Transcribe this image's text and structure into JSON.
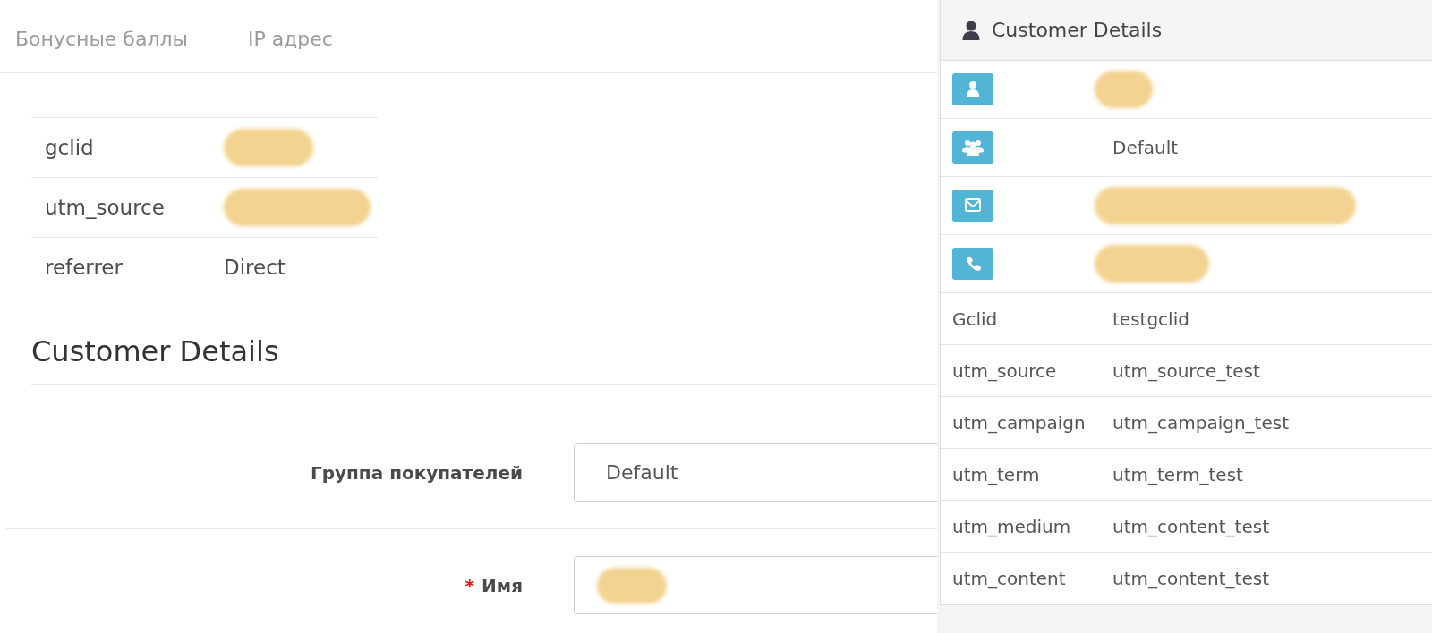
{
  "tabs": [
    {
      "label": "Бонусные баллы",
      "selected": false
    },
    {
      "label": "IP адрес",
      "selected": false
    }
  ],
  "tracking_table": {
    "rows": [
      {
        "label": "gclid",
        "redacted": true
      },
      {
        "label": "utm_source",
        "redacted": true
      },
      {
        "label": "referrer",
        "value": "Direct",
        "redacted": false
      }
    ]
  },
  "customer_details": {
    "heading": "Customer Details",
    "fields": [
      {
        "label": "Группа покупателей",
        "value": "Default",
        "redacted": false
      },
      {
        "label": "Имя",
        "required_mark": "*",
        "redacted": true
      }
    ]
  },
  "customer_panel": {
    "title": "Customer Details",
    "contact_rows": [
      {
        "kind": "name",
        "redacted": true
      },
      {
        "kind": "group",
        "value": "Default",
        "redacted": false
      },
      {
        "kind": "email",
        "redacted": true
      },
      {
        "kind": "phone",
        "redacted": true
      }
    ],
    "tracking_rows": [
      {
        "label": "Gclid",
        "value": "testgclid"
      },
      {
        "label": "utm_source",
        "value": "utm_source_test"
      },
      {
        "label": "utm_campaign",
        "value": "utm_campaign_test"
      },
      {
        "label": "utm_term",
        "value": "utm_term_test"
      },
      {
        "label": "utm_medium",
        "value": "utm_content_test"
      },
      {
        "label": "utm_content",
        "value": "utm_content_test"
      }
    ]
  }
}
